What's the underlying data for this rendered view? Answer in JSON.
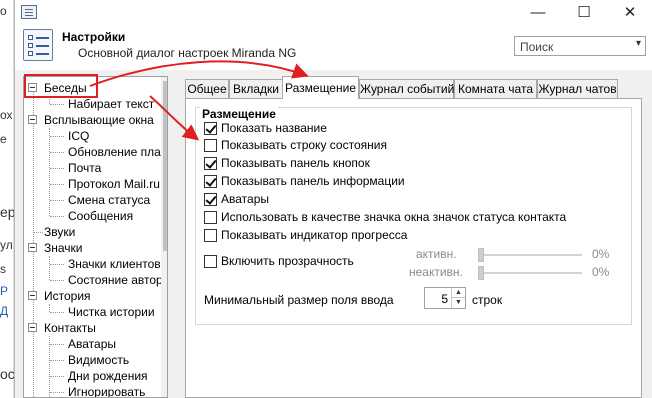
{
  "window": {
    "title": "Настройки",
    "subtitle": "Основной диалог настроек Miranda NG",
    "minimize_glyph": "—",
    "maximize_glyph": "☐",
    "close_glyph": "✕",
    "search": {
      "placeholder": "Поиск",
      "dropdown_glyph": "▾"
    }
  },
  "background_fragments": [
    "о",
    "ох",
    "е",
    "ер",
    "ул",
    "s",
    "Р",
    "Д",
    "ос"
  ],
  "tree": {
    "items": [
      {
        "label": "Беседы",
        "level": 0,
        "expandable": true
      },
      {
        "label": "Набирает текст",
        "level": 1
      },
      {
        "label": "Всплывающие окна",
        "level": 0,
        "expandable": true
      },
      {
        "label": "ICQ",
        "level": 1
      },
      {
        "label": "Обновление плаги",
        "level": 1
      },
      {
        "label": "Почта",
        "level": 1
      },
      {
        "label": "Протокол Mail.ru А",
        "level": 1
      },
      {
        "label": "Смена статуса",
        "level": 1
      },
      {
        "label": "Сообщения",
        "level": 1
      },
      {
        "label": "Звуки",
        "level": 0
      },
      {
        "label": "Значки",
        "level": 0,
        "expandable": true
      },
      {
        "label": "Значки клиентов",
        "level": 1
      },
      {
        "label": "Состояние автори",
        "level": 1
      },
      {
        "label": "История",
        "level": 0,
        "expandable": true
      },
      {
        "label": "Чистка истории",
        "level": 1
      },
      {
        "label": "Контакты",
        "level": 0,
        "expandable": true
      },
      {
        "label": "Аватары",
        "level": 1
      },
      {
        "label": "Видимость",
        "level": 1
      },
      {
        "label": "Дни рождения",
        "level": 1
      },
      {
        "label": "Игнорировать",
        "level": 1
      }
    ]
  },
  "tabs": [
    {
      "label": "Общее",
      "active": false
    },
    {
      "label": "Вкладки",
      "active": false
    },
    {
      "label": "Размещение",
      "active": true
    },
    {
      "label": "Журнал событий",
      "active": false
    },
    {
      "label": "Комната чата",
      "active": false
    },
    {
      "label": "Журнал чатов",
      "active": false
    }
  ],
  "layout_group": {
    "title": "Размещение",
    "options": [
      {
        "label": "Показать название",
        "checked": true
      },
      {
        "label": "Показывать строку состояния",
        "checked": false
      },
      {
        "label": "Показывать панель кнопок",
        "checked": true
      },
      {
        "label": "Показывать панель информации",
        "checked": true
      },
      {
        "label": "Аватары",
        "checked": true
      },
      {
        "label": "Использовать в качестве значка окна значок статуса контакта",
        "checked": false
      },
      {
        "label": "Показывать индикатор прогресса",
        "checked": false
      }
    ],
    "transparency": {
      "label": "Включить прозрачность",
      "checked": false,
      "active_label": "активн.",
      "active_value": "0%",
      "inactive_label": "неактивн.",
      "inactive_value": "0%"
    }
  },
  "min_input": {
    "label": "Минимальный размер поля ввода",
    "value": "5",
    "unit": "строк"
  },
  "annotation_color": "#e02020"
}
